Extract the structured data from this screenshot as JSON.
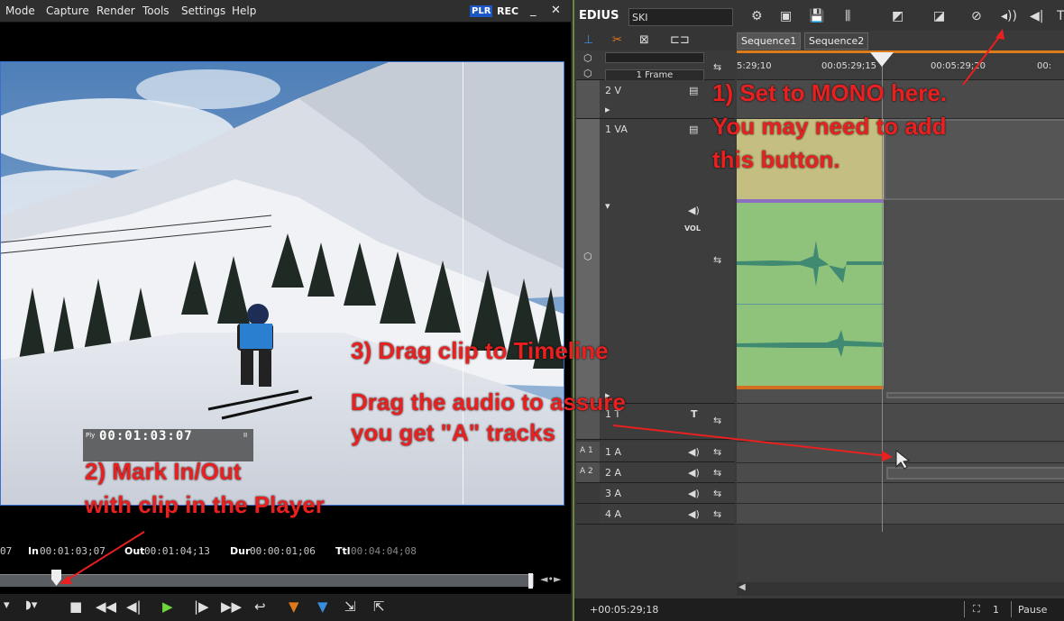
{
  "player": {
    "menu": [
      "Mode",
      "Capture",
      "Render",
      "Tools",
      "Settings",
      "Help"
    ],
    "plr_badge": "PLR",
    "rec_label": "REC",
    "minimize": "_",
    "close": "✕",
    "overlay": {
      "ply": "Ply",
      "timecode": "00:01:03:07",
      "marker": "II"
    },
    "info": {
      "edge_value": "07",
      "in_label": "In",
      "in_value": "00:01:03;07",
      "out_label": "Out",
      "out_value": "00:01:04;13",
      "dur_label": "Dur",
      "dur_value": "00:00:01;06",
      "ttl_label": "Ttl",
      "ttl_value": "00:04:04;08"
    },
    "scrub_position": 0.097,
    "transport": {
      "stop": "■",
      "rewind": "◀◀",
      "step_back": "◀|",
      "play": "▶",
      "step_fwd": "|▶",
      "ffwd": "▶▶",
      "loop": "↩",
      "set_in": "▼",
      "set_out": "▼",
      "insert": "⇲",
      "overwrite": "⇱"
    }
  },
  "timeline": {
    "app_title": "EDIUS",
    "sequence_name": "SKI",
    "tabs": [
      "Sequence1",
      "Sequence2"
    ],
    "zoom_label": "1 Frame",
    "ruler_ticks": [
      "5:29;10",
      "00:05:29;15",
      "00:05:29;20",
      "00:"
    ],
    "tracks": [
      {
        "name": "2 V"
      },
      {
        "name": "1 VA",
        "vol": "VOL"
      },
      {
        "name": "1 T",
        "t": "T"
      },
      {
        "name": "1 A",
        "patch": "A 1"
      },
      {
        "name": "2 A",
        "patch": "A 2"
      },
      {
        "name": "3 A"
      },
      {
        "name": "4 A"
      }
    ],
    "status": {
      "timecode": "+00:05:29;18",
      "clip_count": "1",
      "state": "Pause"
    }
  },
  "annotations": {
    "step1": [
      "1) Set to MONO here.",
      "You may need to add",
      "this button."
    ],
    "step2": [
      "2) Mark In/Out",
      "with clip in the Player"
    ],
    "step3": [
      "3) Drag clip to Timeline"
    ],
    "drag_audio": [
      "Drag the audio to assure",
      "you get \"A\" tracks"
    ]
  },
  "colors": {
    "annotation_red": "#e82020",
    "video_clip": "#c4bf80",
    "audio_clip": "#8fc37c",
    "playhead_orange": "#e07b1a",
    "plr_blue": "#1c56c4"
  }
}
